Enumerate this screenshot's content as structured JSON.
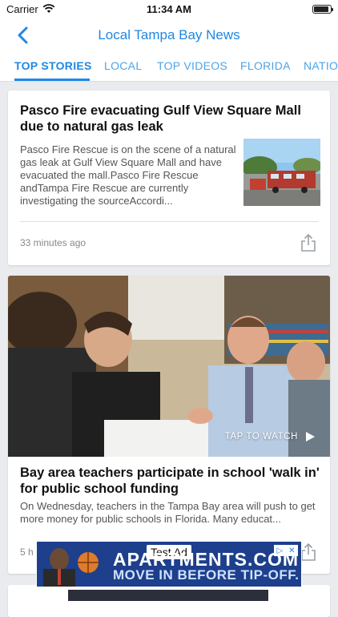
{
  "status_bar": {
    "carrier": "Carrier",
    "time": "11:34 AM",
    "battery_level": 0.9
  },
  "nav": {
    "title": "Local Tampa Bay News"
  },
  "tabs": [
    {
      "label": "TOP STORIES",
      "active": true
    },
    {
      "label": "LOCAL",
      "active": false
    },
    {
      "label": "TOP VIDEOS",
      "active": false
    },
    {
      "label": "FLORIDA",
      "active": false
    },
    {
      "label": "NATIO",
      "active": false
    }
  ],
  "articles": [
    {
      "headline": "Pasco Fire evacuating Gulf View Square Mall due to natural gas leak",
      "summary": "Pasco Fire Rescue is on the scene of a natural gas leak at Gulf View Square Mall and have evacuated the mall.Pasco Fire Rescue andTampa Fire Rescue are currently investigating the sourceAccordi...",
      "time": "33 minutes ago"
    },
    {
      "headline": "Bay area teachers participate in school 'walk in' for public school funding",
      "summary": "On Wednesday, teachers in the Tampa Bay area will push to get more money for public schools in Florida. Many educat...",
      "tap_label": "TAP TO WATCH",
      "time": "5 h"
    }
  ],
  "ad": {
    "label": "Test Ad",
    "line1": "APARTMENTS.COM",
    "line2": "MOVE IN BEFORE TIP-OFF."
  },
  "colors": {
    "accent": "#1e88e5",
    "background": "#e9ebee",
    "ad_background": "#1d3f8c"
  }
}
